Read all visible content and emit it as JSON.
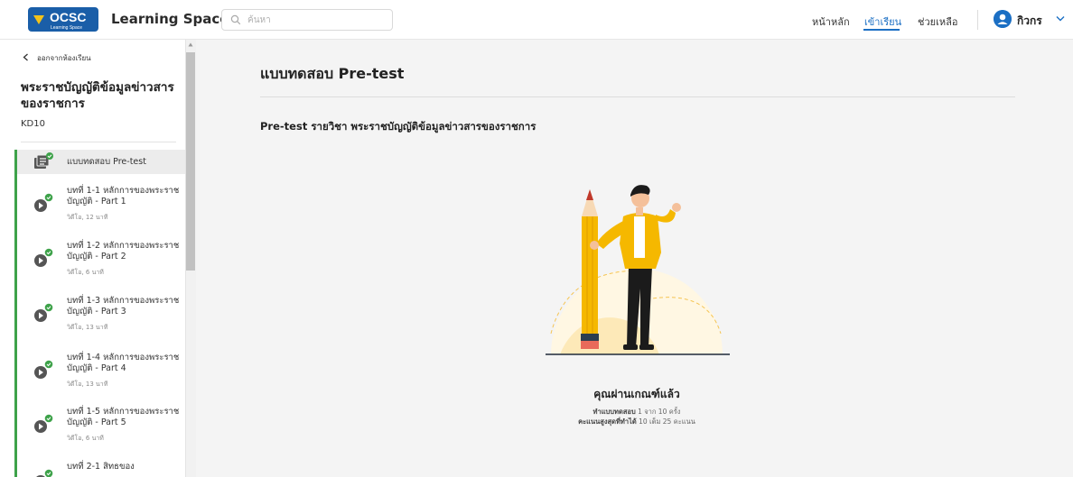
{
  "header": {
    "logo_text": "OCSC",
    "logo_subtext": "Learning Space",
    "app_title": "Learning Space",
    "search_placeholder": "ค้นหา",
    "nav": {
      "home": "หน้าหลัก",
      "learn": "เข้าเรียน",
      "help": "ช่วยเหลือ"
    },
    "user_name": "กิวกร"
  },
  "sidebar": {
    "back_label": "ออกจากห้องเรียน",
    "course_title": "พระราชบัญญัติข้อมูลข่าวสารของราชการ",
    "course_code": "KD10",
    "items": [
      {
        "title": "แบบทดสอบ Pre-test",
        "meta": "",
        "icon": "quiz-document-icon",
        "completed": true,
        "active": true
      },
      {
        "title": "บทที่ 1-1 หลักการของพระราชบัญญัติ - Part 1",
        "meta": "วิดีโอ, 12 นาที",
        "icon": "video-play-icon",
        "completed": true
      },
      {
        "title": "บทที่ 1-2 หลักการของพระราชบัญญัติ - Part 2",
        "meta": "วิดีโอ, 6 นาที",
        "icon": "video-play-icon",
        "completed": true
      },
      {
        "title": "บทที่ 1-3 หลักการของพระราชบัญญัติ - Part 3",
        "meta": "วิดีโอ, 13 นาที",
        "icon": "video-play-icon",
        "completed": true
      },
      {
        "title": "บทที่ 1-4 หลักการของพระราชบัญญัติ - Part 4",
        "meta": "วิดีโอ, 13 นาที",
        "icon": "video-play-icon",
        "completed": true
      },
      {
        "title": "บทที่ 1-5 หลักการของพระราชบัญญัติ - Part 5",
        "meta": "วิดีโอ, 6 นาที",
        "icon": "video-play-icon",
        "completed": true
      },
      {
        "title": "บทที่ 2-1 สิทธของ",
        "meta": "",
        "icon": "video-play-icon",
        "completed": true
      }
    ]
  },
  "main": {
    "page_title": "แบบทดสอบ Pre-test",
    "subtitle": "Pre-test รายวิชา พระราชบัญญัติข้อมูลข่าวสารของราชการ",
    "result_title": "คุณผ่านเกณฑ์แล้ว",
    "attempts_label": "ทำแบบทดสอบ",
    "attempts_value": "1 จาก 10 ครั้ง",
    "best_score_label": "คะแนนสูงสุดที่ทำได้",
    "best_score_value": "10 เต็ม 25 คะแนน"
  },
  "colors": {
    "accent": "#1b6fc4",
    "complete_green": "#3ea24a",
    "logo_bg": "#1a5ea8",
    "logo_accent": "#f2c21b",
    "illustration_yellow": "#f5b800"
  }
}
